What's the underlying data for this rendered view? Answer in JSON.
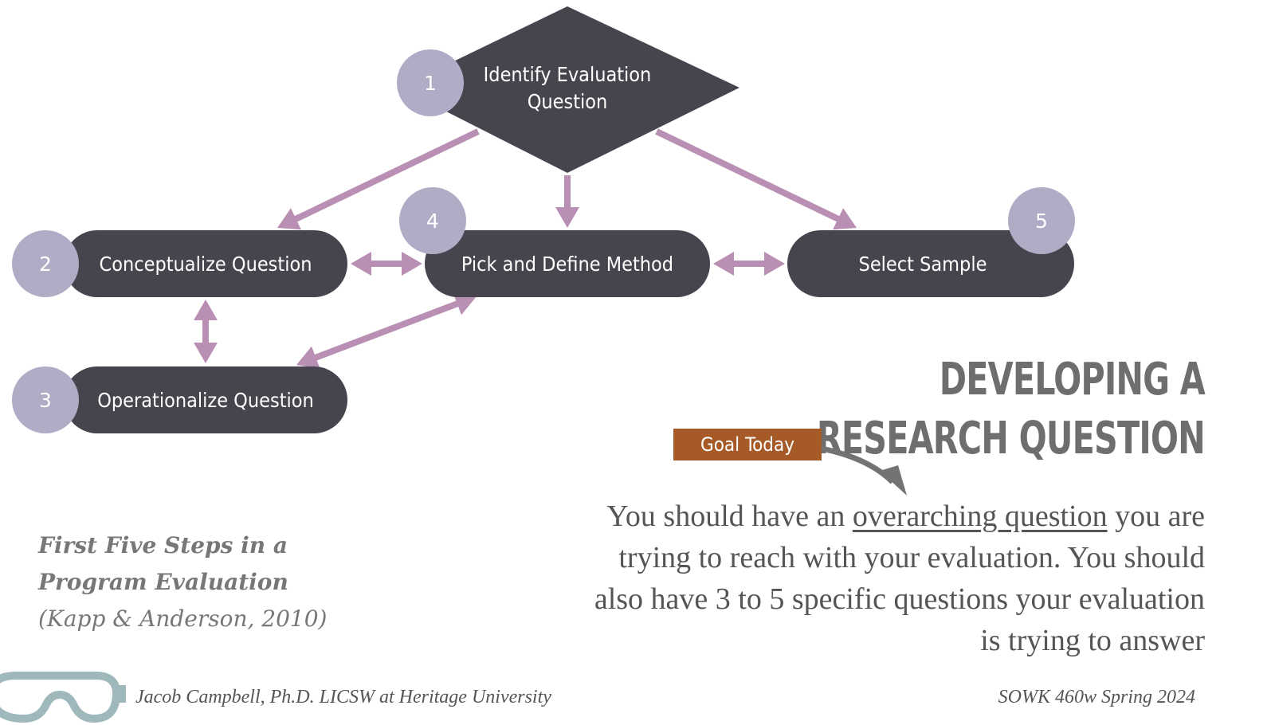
{
  "colors": {
    "node_fill": "#47444e",
    "badge_fill": "#b1abc6",
    "arrow": "#b98fb4",
    "goal_badge": "#a65a27",
    "title_text": "#6e6e6e",
    "goggles": "#9fb8bb"
  },
  "diagram": {
    "nodes": [
      {
        "id": "identify",
        "step": "1",
        "label_lines": [
          "Identify Evaluation",
          "Question"
        ],
        "shape": "diamond"
      },
      {
        "id": "conceptualize",
        "step": "2",
        "label_lines": [
          "Conceptualize Question"
        ],
        "shape": "pill"
      },
      {
        "id": "operationalize",
        "step": "3",
        "label_lines": [
          "Operationalize Question"
        ],
        "shape": "pill"
      },
      {
        "id": "method",
        "step": "4",
        "label_lines": [
          "Pick and Define Method"
        ],
        "shape": "pill"
      },
      {
        "id": "sample",
        "step": "5",
        "label_lines": [
          "Select Sample"
        ],
        "shape": "pill"
      }
    ],
    "edges": [
      {
        "from": "identify",
        "to": "conceptualize",
        "direction": "one-way"
      },
      {
        "from": "identify",
        "to": "method",
        "direction": "one-way"
      },
      {
        "from": "identify",
        "to": "sample",
        "direction": "one-way"
      },
      {
        "from": "conceptualize",
        "to": "method",
        "direction": "two-way"
      },
      {
        "from": "method",
        "to": "sample",
        "direction": "two-way"
      },
      {
        "from": "conceptualize",
        "to": "operationalize",
        "direction": "two-way"
      },
      {
        "from": "operationalize",
        "to": "method",
        "direction": "two-way"
      }
    ]
  },
  "title": {
    "line1": "DEVELOPING A",
    "line2": "RESEARCH QUESTION"
  },
  "goal_badge": "Goal Today",
  "body": {
    "before": "You should have an ",
    "emphasis": "overarching question",
    "after": " you are trying to reach with your evaluation. You should also have 3 to 5 specific questions your evaluation is trying to answer"
  },
  "caption": {
    "line1": "First Five Steps in a",
    "line2": "Program Evaluation",
    "citation": "(Kapp & Anderson, 2010)"
  },
  "footer": {
    "author": "Jacob Campbell, Ph.D. LICSW at Heritage University",
    "course": "SOWK 460w Spring 2024"
  }
}
